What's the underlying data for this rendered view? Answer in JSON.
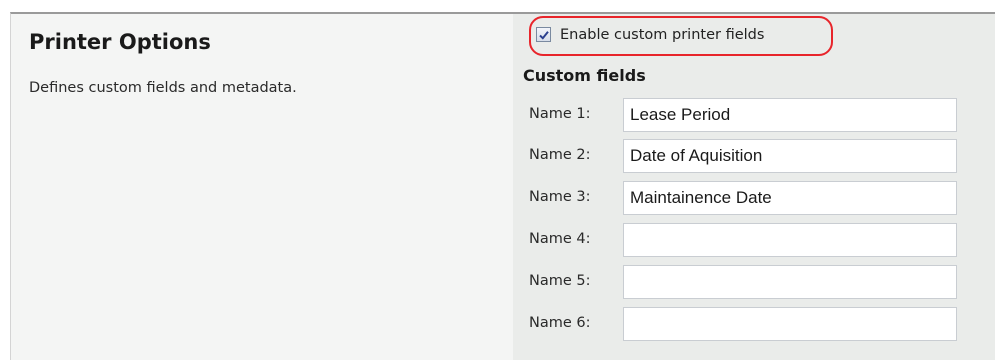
{
  "panel": {
    "title": "Printer Options",
    "description": "Defines custom fields and metadata."
  },
  "enable_checkbox": {
    "label": "Enable custom printer fields",
    "checked": true
  },
  "custom_fields": {
    "heading": "Custom fields",
    "rows": [
      {
        "label": "Name 1:",
        "value": "Lease Period"
      },
      {
        "label": "Name 2:",
        "value": "Date of Aquisition"
      },
      {
        "label": "Name 3:",
        "value": "Maintainence Date"
      },
      {
        "label": "Name 4:",
        "value": ""
      },
      {
        "label": "Name 5:",
        "value": ""
      },
      {
        "label": "Name 6:",
        "value": ""
      }
    ]
  },
  "colors": {
    "highlight_outline": "#e8252b",
    "left_background": "#f4f5f4",
    "right_background": "#eaecea"
  }
}
